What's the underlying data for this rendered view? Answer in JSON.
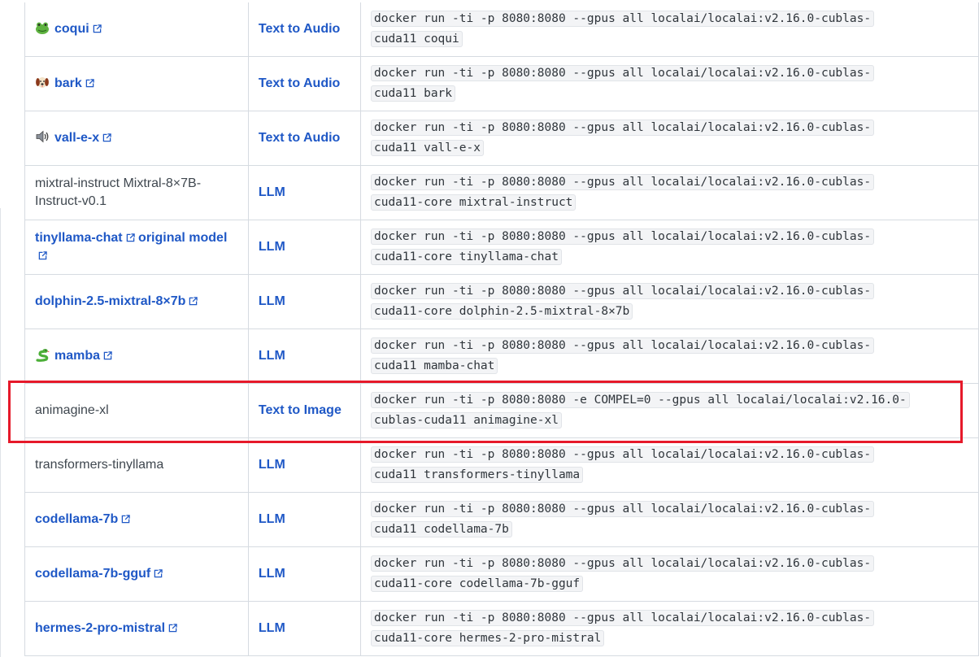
{
  "colors": {
    "link": "#1f58c6",
    "highlight_border": "#e6192a",
    "code_bg": "#f3f4f6"
  },
  "rows": [
    {
      "model": "coqui",
      "icon": "frog-emoji-icon",
      "link": true,
      "usecase": "Text to Audio",
      "cmd": [
        "docker run -ti -p 8080:8080 --gpus all localai/localai:v2.16.0-cublas-",
        "cuda11 coqui"
      ]
    },
    {
      "model": "bark",
      "icon": "dog-emoji-icon",
      "link": true,
      "usecase": "Text to Audio",
      "cmd": [
        "docker run -ti -p 8080:8080 --gpus all localai/localai:v2.16.0-cublas-",
        "cuda11 bark"
      ]
    },
    {
      "model": "vall-e-x",
      "icon": "speaker-icon",
      "link": true,
      "usecase": "Text to Audio",
      "cmd": [
        "docker run -ti -p 8080:8080 --gpus all localai/localai:v2.16.0-cublas-",
        "cuda11 vall-e-x"
      ]
    },
    {
      "model": "mixtral-instruct Mixtral-8×7B-Instruct-v0.1",
      "icon": "",
      "link": false,
      "usecase": "LLM",
      "cmd": [
        "docker run -ti -p 8080:8080 --gpus all localai/localai:v2.16.0-cublas-",
        "cuda11-core mixtral-instruct"
      ]
    },
    {
      "model": "tinyllama-chat",
      "model_extra": "original model",
      "icon": "",
      "link": true,
      "usecase": "LLM",
      "cmd": [
        "docker run -ti -p 8080:8080 --gpus all localai/localai:v2.16.0-cublas-",
        "cuda11-core tinyllama-chat"
      ]
    },
    {
      "model": "dolphin-2.5-mixtral-8×7b",
      "icon": "",
      "link": true,
      "usecase": "LLM",
      "cmd": [
        "docker run -ti -p 8080:8080 --gpus all localai/localai:v2.16.0-cublas-",
        "cuda11-core dolphin-2.5-mixtral-8×7b"
      ]
    },
    {
      "model": "mamba",
      "icon": "snake-emoji-icon",
      "link": true,
      "usecase": "LLM",
      "cmd": [
        "docker run -ti -p 8080:8080 --gpus all localai/localai:v2.16.0-cublas-",
        "cuda11 mamba-chat"
      ]
    },
    {
      "model": "animagine-xl",
      "icon": "",
      "link": false,
      "usecase": "Text to Image",
      "highlighted": true,
      "cmd": [
        "docker run -ti -p 8080:8080 -e COMPEL=0 --gpus all localai/localai:v2.16.0-",
        "cublas-cuda11 animagine-xl"
      ]
    },
    {
      "model": "transformers-tinyllama",
      "icon": "",
      "link": false,
      "usecase": "LLM",
      "cmd": [
        "docker run -ti -p 8080:8080 --gpus all localai/localai:v2.16.0-cublas-",
        "cuda11 transformers-tinyllama"
      ]
    },
    {
      "model": "codellama-7b",
      "icon": "",
      "link": true,
      "usecase": "LLM",
      "cmd": [
        "docker run -ti -p 8080:8080 --gpus all localai/localai:v2.16.0-cublas-",
        "cuda11 codellama-7b"
      ]
    },
    {
      "model": "codellama-7b-gguf",
      "icon": "",
      "link": true,
      "usecase": "LLM",
      "cmd": [
        "docker run -ti -p 8080:8080 --gpus all localai/localai:v2.16.0-cublas-",
        "cuda11-core codellama-7b-gguf"
      ]
    },
    {
      "model": "hermes-2-pro-mistral",
      "icon": "",
      "link": true,
      "usecase": "LLM",
      "cmd": [
        "docker run -ti -p 8080:8080 --gpus all localai/localai:v2.16.0-cublas-",
        "cuda11-core hermes-2-pro-mistral"
      ]
    }
  ]
}
